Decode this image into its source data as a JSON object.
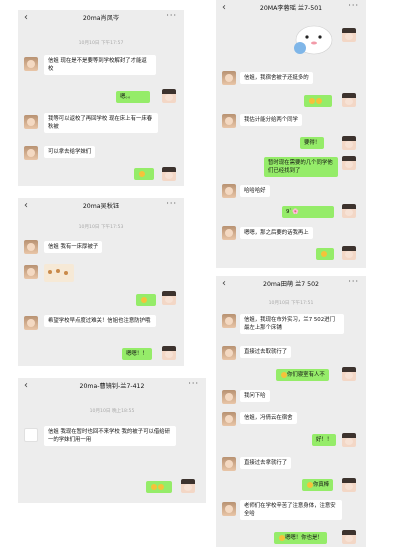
{
  "panel1": {
    "title": "20ma肖凤岑",
    "back_icon": "chevron-left-icon",
    "more_icon": "more-dots-icon",
    "timestamp": "10月10日 下午17:57",
    "messages": [
      {
        "side": "in",
        "text": "信姐 现在是不是要等到学校解封了才能返校"
      },
      {
        "side": "out",
        "text": "嗯。。"
      },
      {
        "side": "in",
        "text": "我等可以返校了再回学校 现在床上有一床春秋被"
      },
      {
        "side": "in",
        "text": "可以拿去给学妹们"
      },
      {
        "side": "out",
        "text": "[emoji]"
      }
    ]
  },
  "panel2": {
    "title": "20ma吴秋钰",
    "timestamp": "10月10日 下午17:53",
    "messages": [
      {
        "side": "in",
        "text": "信姐 我有一床厚被子"
      },
      {
        "side": "in",
        "text": "[image]"
      },
      {
        "side": "out",
        "text": "[emoji]"
      },
      {
        "side": "in",
        "text": "希望学校早点度过难关！信姐也注意防护哦"
      },
      {
        "side": "out",
        "text": "嗯嗯！！"
      }
    ]
  },
  "panel3": {
    "title": "20ma-曹镜钊-兰7-412",
    "timestamp": "10月10日 晚上18:55",
    "messages": [
      {
        "side": "in",
        "text": "信姐 我现在暂时也回不来学校 我的被子可以借给研一的学妹们用一用"
      },
      {
        "side": "out",
        "text": "[emoji]"
      }
    ]
  },
  "panel4": {
    "title": "20MA李蓉瑶 兰7-501",
    "messages": [
      {
        "side": "out",
        "text": "[sticker]"
      },
      {
        "side": "in",
        "text": "信姐，我宿舍被子还挺多的"
      },
      {
        "side": "out",
        "text": "[emoji]"
      },
      {
        "side": "in",
        "text": "我估计能分给两个同学"
      },
      {
        "side": "out",
        "text": "要得！"
      },
      {
        "side": "out",
        "text": "暂时现在需要的几个同学他们已经找到了"
      },
      {
        "side": "in",
        "text": "哈哈哈好"
      },
      {
        "side": "out",
        "text": "9`🌸"
      },
      {
        "side": "in",
        "text": "嗯嗯，那之后要的话我再上"
      },
      {
        "side": "out",
        "text": "[emoji]"
      }
    ]
  },
  "panel5": {
    "title": "20ma田萌 兰7 502",
    "timestamp": "10月10日 下午17:51",
    "messages": [
      {
        "side": "in",
        "text": "信姐，我现在市外实习，兰7 502进门最左上那个床铺"
      },
      {
        "side": "in",
        "text": "直接过去取就行了"
      },
      {
        "side": "out",
        "text": "你们寝室有人不"
      },
      {
        "side": "in",
        "text": "我问下哈"
      },
      {
        "side": "in",
        "text": "信姐，冯倩云在宿舍"
      },
      {
        "side": "out",
        "text": "好！！"
      },
      {
        "side": "in",
        "text": "直接过去拿就行了"
      },
      {
        "side": "out",
        "text": "你真棒"
      },
      {
        "side": "in",
        "text": "老师们在学校辛苦了注意身体，注意安全哈"
      },
      {
        "side": "out",
        "text": "嗯嗯！你也是！"
      }
    ]
  },
  "colors": {
    "chat_bg": "#ededed",
    "bubble_out": "#95ec69",
    "bubble_in": "#ffffff",
    "timestamp": "#a9a9a9"
  }
}
